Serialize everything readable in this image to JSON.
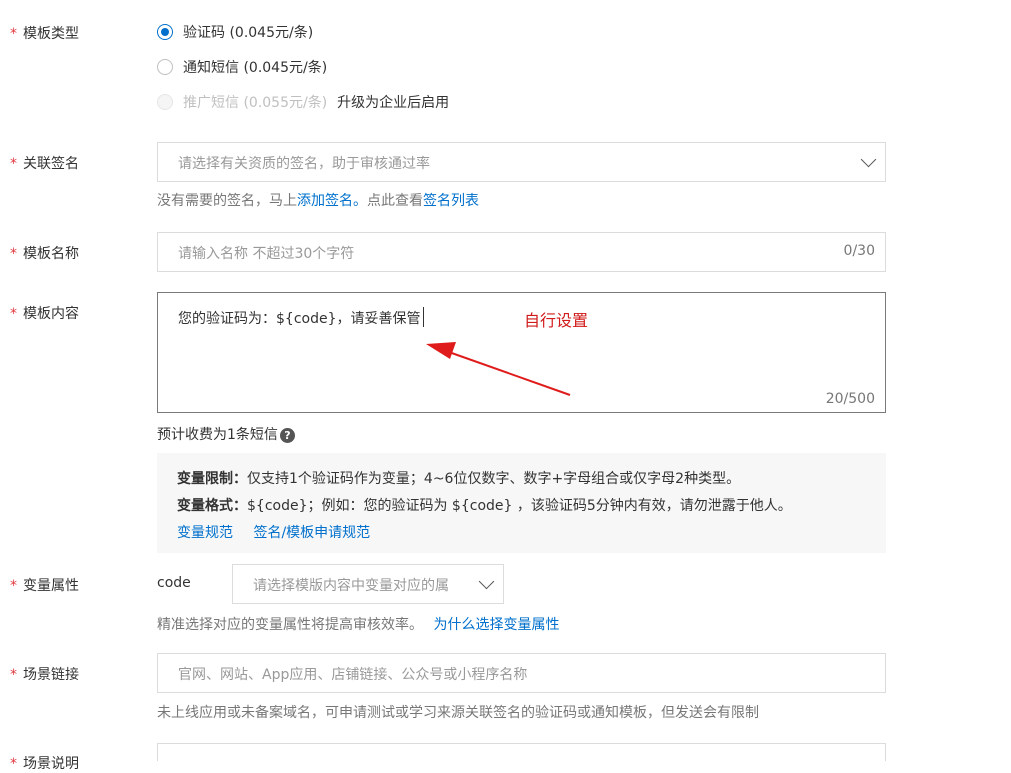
{
  "template_type": {
    "label": "模板类型",
    "options": [
      {
        "text": "验证码 (0.045元/条)",
        "checked": true,
        "disabled": false
      },
      {
        "text": "通知短信 (0.045元/条)",
        "checked": false,
        "disabled": false
      },
      {
        "text": "推广短信 (0.055元/条)",
        "checked": false,
        "disabled": true
      }
    ],
    "upgrade_note": "升级为企业后启用"
  },
  "signature": {
    "label": "关联签名",
    "placeholder": "请选择有关资质的签名，助于审核通过率",
    "hint_prefix": "没有需要的签名，马上",
    "add_link": "添加签名。",
    "hint_middle": "点此查看",
    "list_link": "签名列表"
  },
  "template_name": {
    "label": "模板名称",
    "placeholder": "请输入名称 不超过30个字符",
    "counter": "0/30"
  },
  "template_content": {
    "label": "模板内容",
    "value": "您的验证码为：${code}，请妥善保管",
    "annotation": "自行设置",
    "counter": "20/500",
    "cost_hint": "预计收费为1条短信",
    "help_icon": "question-circle-icon"
  },
  "info_panel": {
    "restriction_label": "变量限制：",
    "restriction_text": "仅支持1个验证码作为变量；4~6位仅数字、数字+字母组合或仅字母2种类型。",
    "format_label": "变量格式：",
    "format_text": "${code}；例如：您的验证码为 ${code} ，该验证码5分钟内有效，请勿泄露于他人。",
    "link_1": "变量规范",
    "link_2": "签名/模板申请规范"
  },
  "variable_attr": {
    "label": "变量属性",
    "variable_name": "code",
    "placeholder": "请选择模版内容中变量对应的属",
    "hint": "精准选择对应的变量属性将提高审核效率。",
    "hint_link": "为什么选择变量属性"
  },
  "scene_link": {
    "label": "场景链接",
    "placeholder": "官网、网站、App应用、店铺链接、公众号或小程序名称",
    "hint": "未上线应用或未备案域名，可申请测试或学习来源关联签名的验证码或通知模板，但发送会有限制"
  },
  "scene_desc": {
    "label": "场景说明"
  },
  "colors": {
    "accent": "#0070cc",
    "required_star": "#e0393e",
    "annotation_red": "#d11a1a"
  }
}
